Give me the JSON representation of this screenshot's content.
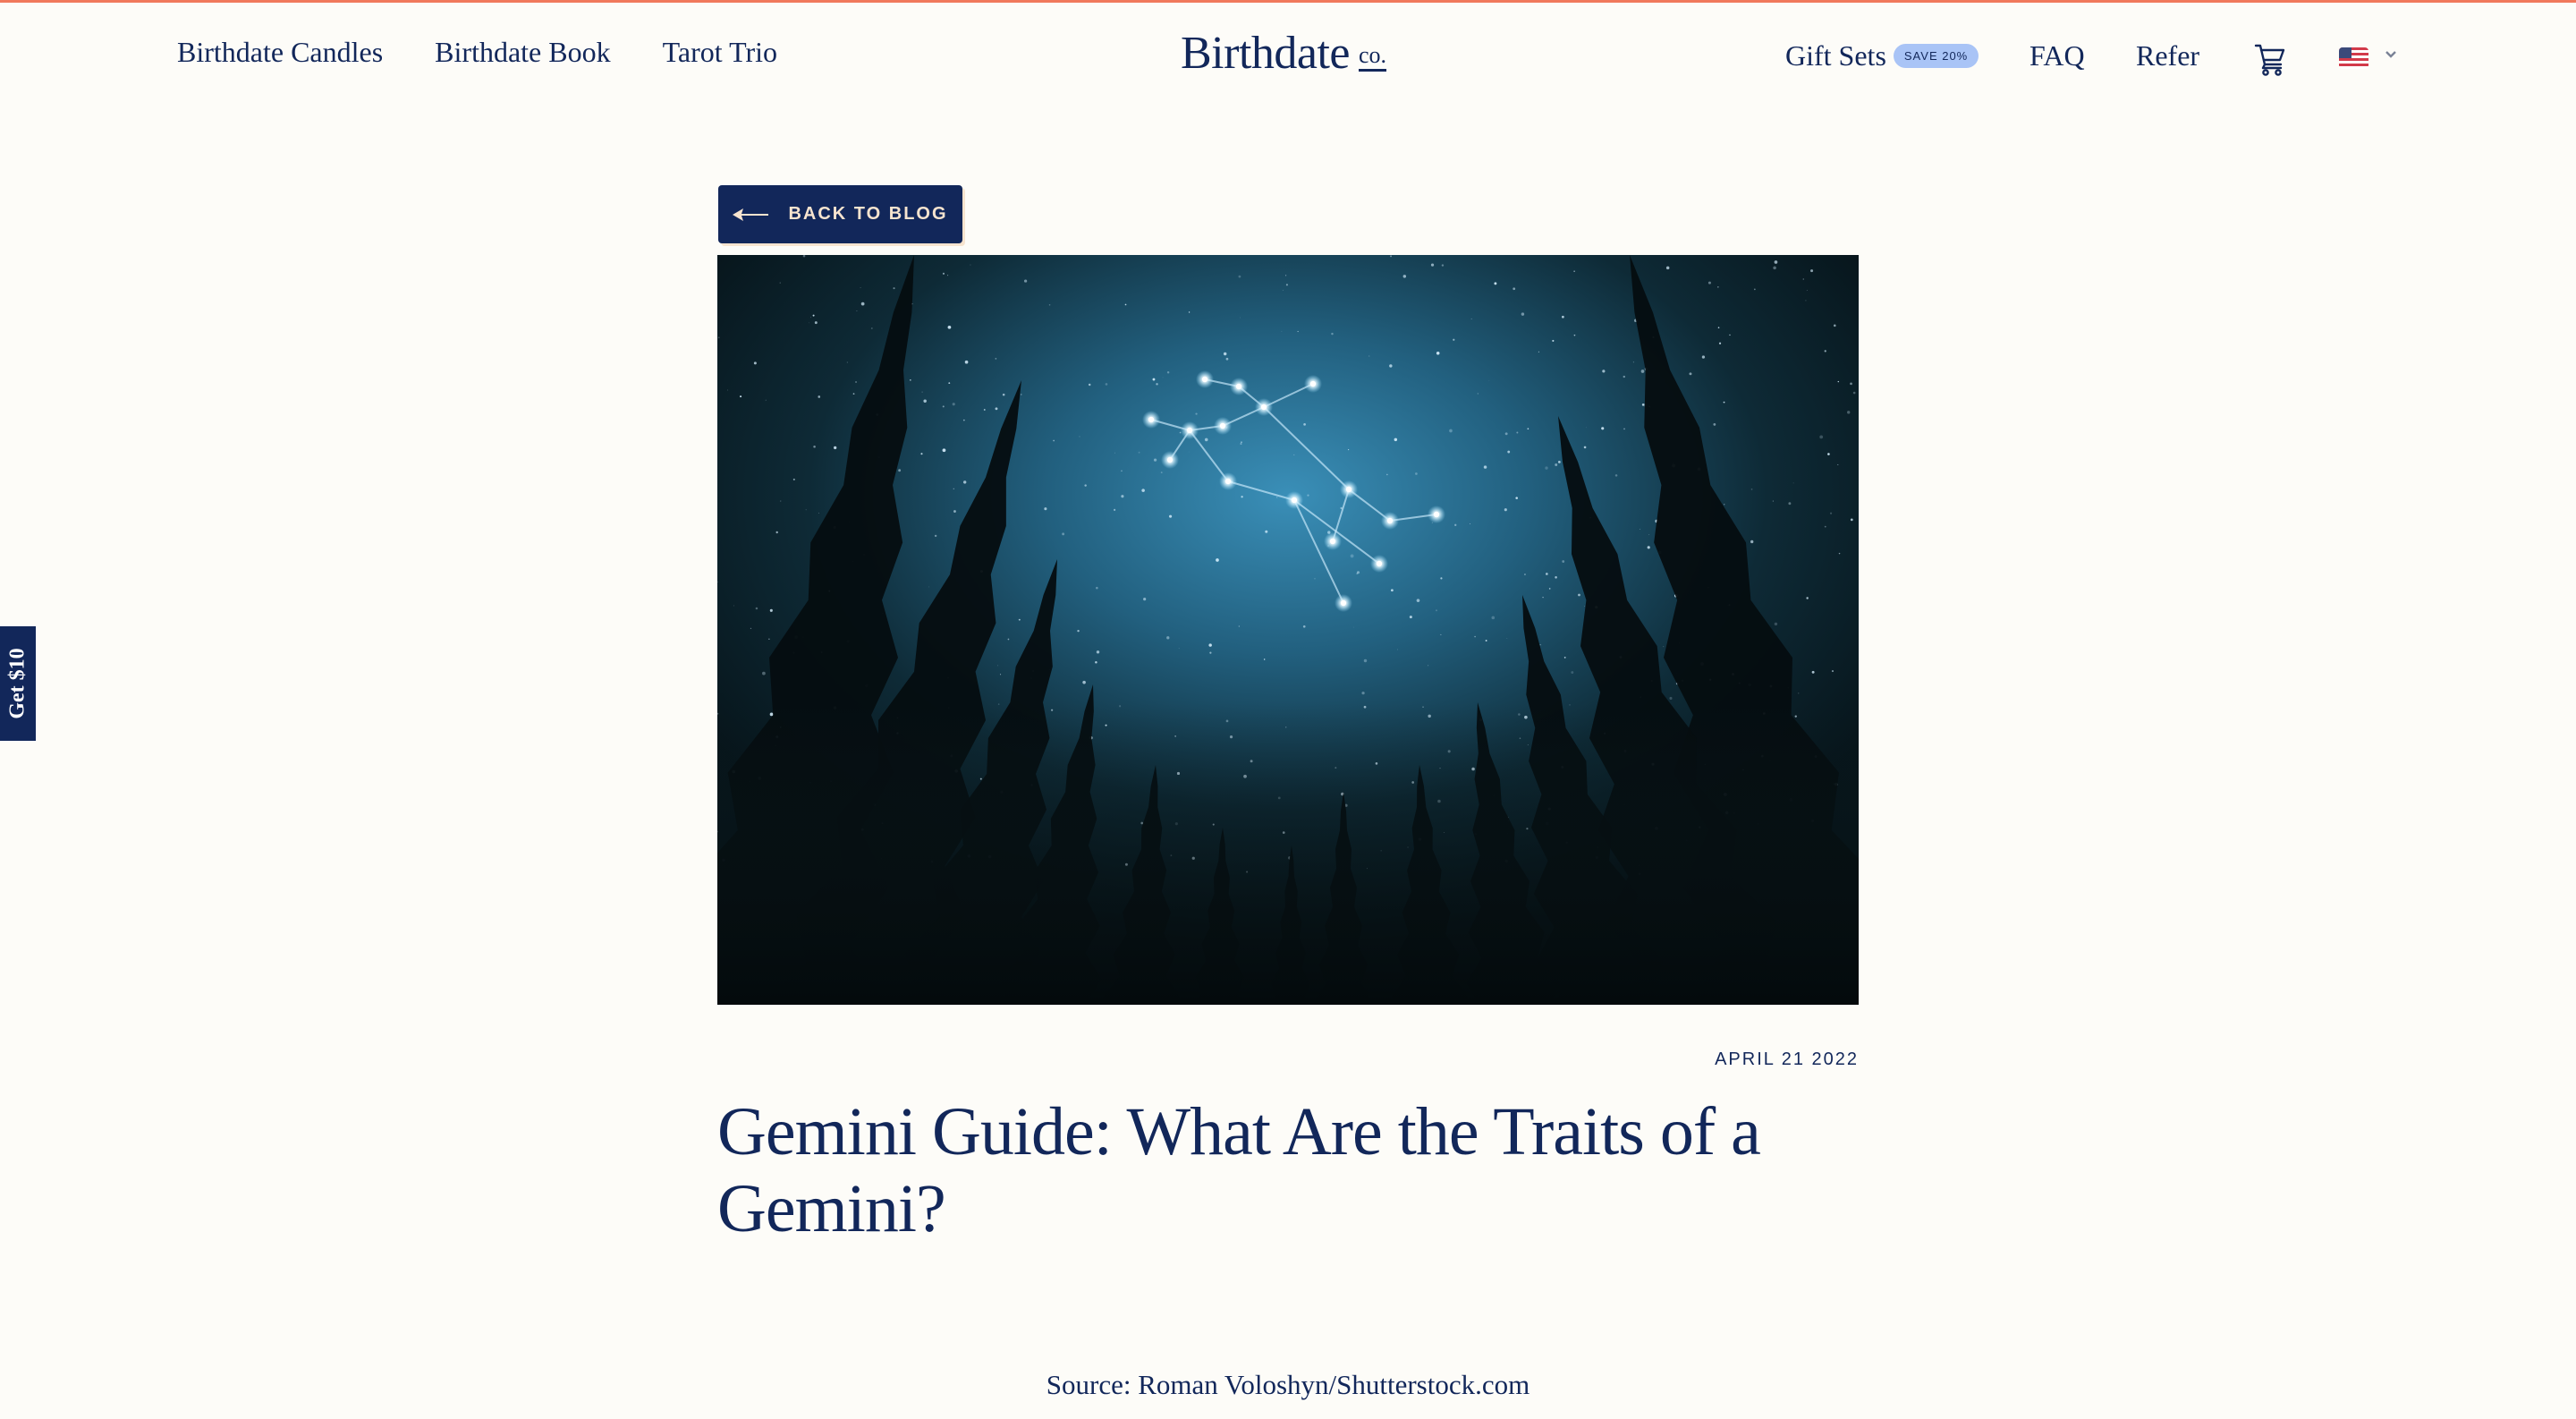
{
  "colors": {
    "accent_bar": "#f0795c",
    "navy": "#12275a",
    "badge_bg": "#a9c4f6",
    "cream": "#f7e4cf",
    "page_bg": "#fdfcf8"
  },
  "nav": {
    "left": [
      {
        "label": "Birthdate Candles"
      },
      {
        "label": "Birthdate Book"
      },
      {
        "label": "Tarot Trio"
      }
    ],
    "logo": {
      "main": "Birthdate",
      "suffix": "co."
    },
    "right": {
      "gift_sets": "Gift Sets",
      "gift_badge": "SAVE 20%",
      "faq": "FAQ",
      "refer": "Refer",
      "cart_icon": "cart-icon",
      "locale_icon": "us-flag-icon",
      "locale_chevron": "chevron-down-icon"
    }
  },
  "back_button": {
    "label": "BACK TO BLOG",
    "icon": "arrow-left-icon"
  },
  "hero": {
    "alt": "Gemini constellation over a forest night sky"
  },
  "article": {
    "date": "APRIL 21 2022",
    "title": "Gemini Guide: What Are the Traits of a Gemini?",
    "source": "Source: Roman Voloshyn/Shutterstock.com"
  },
  "side_tab": {
    "label": "Get $10"
  }
}
